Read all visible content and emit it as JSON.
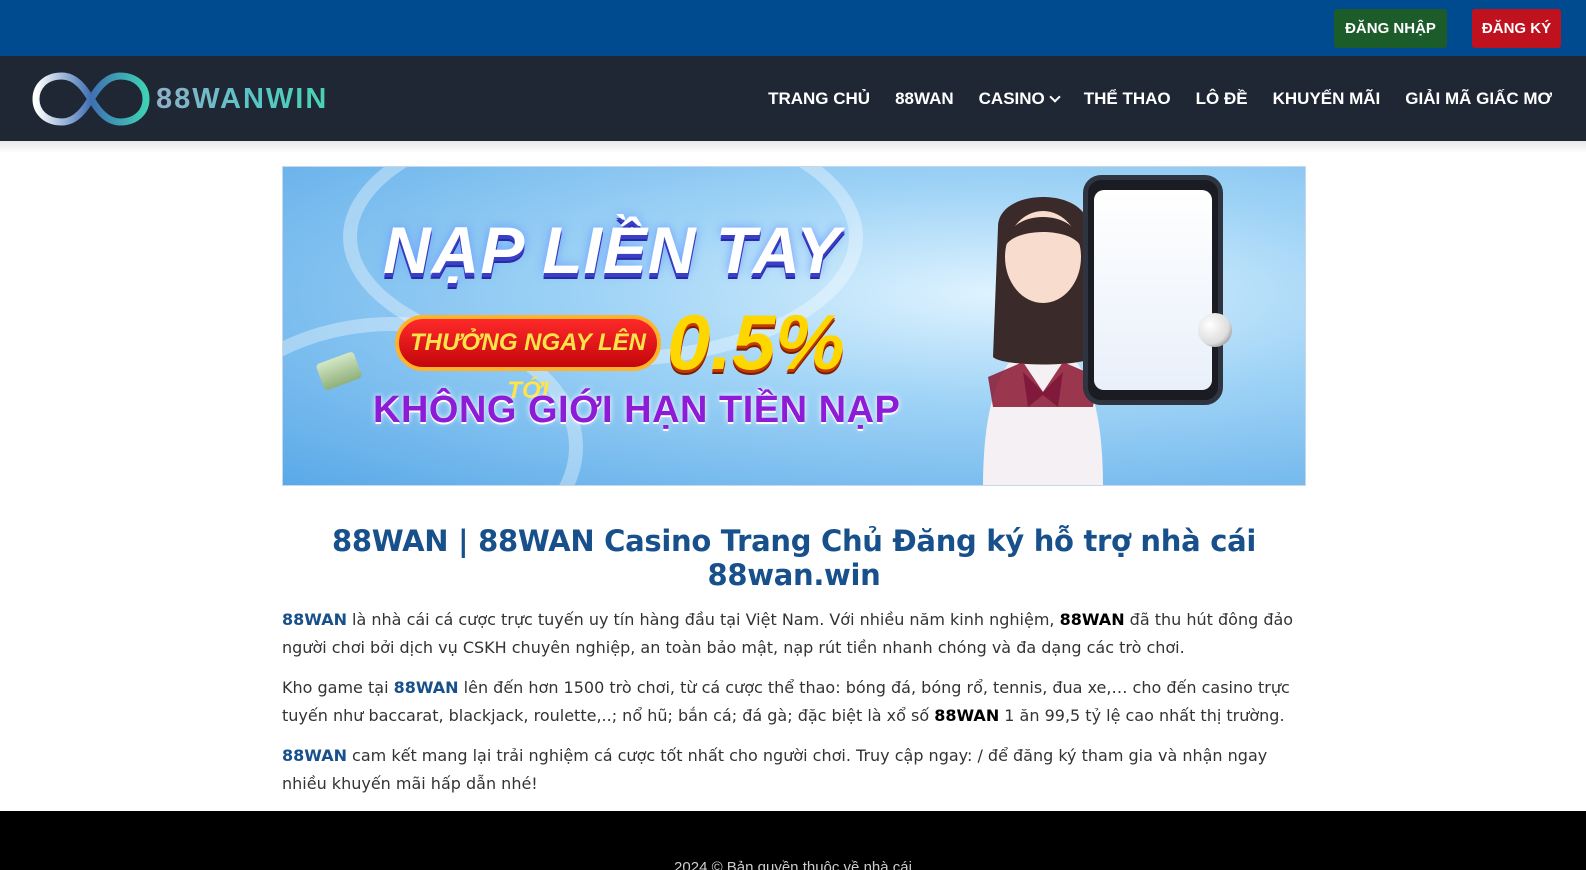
{
  "header": {
    "login_label": "ĐĂNG NHẬP",
    "register_label": "ĐĂNG KÝ"
  },
  "logo": {
    "text": "88WANWIN"
  },
  "nav": {
    "items": [
      {
        "label": "TRANG CHỦ"
      },
      {
        "label": "88WAN"
      },
      {
        "label": "CASINO",
        "has_dropdown": true
      },
      {
        "label": "THỂ THAO"
      },
      {
        "label": "LÔ ĐỀ"
      },
      {
        "label": "KHUYẾN MÃI"
      },
      {
        "label": "GIẢI MÃ GIẤC MƠ"
      }
    ]
  },
  "banner": {
    "headline": "NẠP LIỀN TAY",
    "pill_text": "THƯỞNG NGAY LÊN TỚI",
    "percent": "0.5%",
    "subline": "KHÔNG GIỚI HẠN TIỀN NẠP"
  },
  "article": {
    "title": "88WAN | 88WAN Casino Trang Chủ Đăng ký hỗ trợ nhà cái 88wan.win",
    "p1": {
      "kw1": "88WAN",
      "t1": " là nhà cái cá cược trực tuyến uy tín hàng đầu tại Việt Nam. Với nhiều năm kinh nghiệm, ",
      "kw2": "88WAN",
      "t2": " đã thu hút đông đảo người chơi bởi dịch vụ CSKH chuyên nghiệp, an toàn bảo mật, nạp rút tiền nhanh chóng và đa dạng các trò chơi."
    },
    "p2": {
      "t1": "Kho game tại ",
      "kw1": "88WAN",
      "t2": " lên đến hơn 1500 trò chơi, từ cá cược thể thao: bóng đá, bóng rổ, tennis, đua xe,… cho đến casino trực tuyến như baccarat, blackjack, roulette,..; nổ hũ; bắn cá; đá gà; đặc biệt là xổ số ",
      "kw2": "88WAN",
      "t3": " 1 ăn 99,5 tỷ lệ cao nhất thị trường."
    },
    "p3": {
      "kw1": "88WAN",
      "t1": " cam kết mang lại trải nghiệm cá cược tốt nhất cho người chơi. Truy cập ngay: / để đăng ký tham gia và nhận ngay nhiều khuyến mãi hấp dẫn nhé!"
    }
  },
  "footer": {
    "copyright": "2024 © Bản quyền thuộc về nhà cái"
  },
  "colors": {
    "topbar": "#004a8f",
    "navbar": "#1e2733",
    "login_button": "#1c5c2b",
    "register_button": "#c0111f",
    "keyword": "#17508a"
  }
}
